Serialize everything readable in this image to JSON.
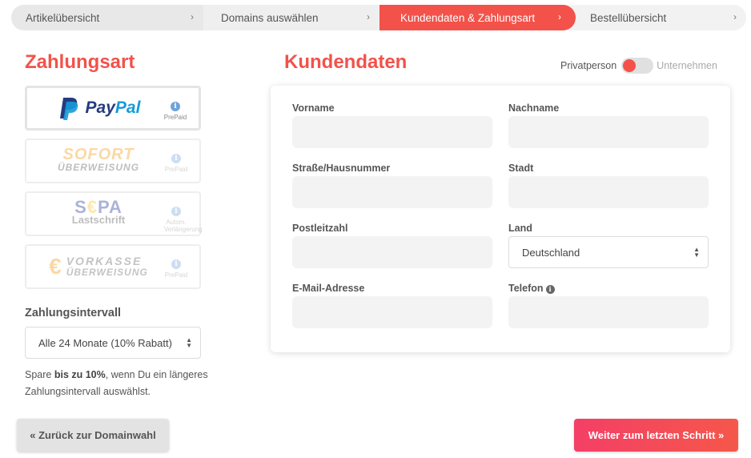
{
  "stepper": {
    "steps": [
      {
        "label": "Artikelübersicht"
      },
      {
        "label": "Domains auswählen"
      },
      {
        "label": "Kundendaten & Zahlungsart"
      },
      {
        "label": "Bestellübersicht"
      }
    ],
    "chevron": "›"
  },
  "payment": {
    "title": "Zahlungsart",
    "methods": [
      {
        "name": "PayPal",
        "logo_a": "Pay",
        "logo_b": "Pal",
        "note": "PrePaid",
        "selected": true
      },
      {
        "name": "Sofort Überweisung",
        "logo_a": "SOFORT",
        "logo_b": "ÜBERWEISUNG",
        "note": "PrePaid",
        "selected": false
      },
      {
        "name": "SEPA Lastschrift",
        "logo_a_1": "S",
        "logo_a_2": "€",
        "logo_a_3": "PA",
        "logo_b": "Lastschrift",
        "note_1": "Autom.",
        "note_2": "Verlängerung",
        "selected": false
      },
      {
        "name": "Vorkasse Überweisung",
        "euro": "€",
        "logo_a": "VORKASSE",
        "logo_b": "ÜBERWEISUNG",
        "note": "PrePaid",
        "selected": false
      }
    ],
    "info_glyph": "i",
    "interval_label": "Zahlungsintervall",
    "interval_value": "Alle 24 Monate (10% Rabatt)",
    "savings_1": "Spare ",
    "savings_bold": "bis zu 10%",
    "savings_2": ", wenn Du ein längeres Zahlungsintervall auswählst."
  },
  "customer": {
    "title": "Kundendaten",
    "toggle_left": "Privatperson",
    "toggle_right": "Unternehmen",
    "fields": {
      "firstname": "Vorname",
      "lastname": "Nachname",
      "street": "Straße/Hausnummer",
      "city": "Stadt",
      "zip": "Postleitzahl",
      "country": "Land",
      "country_value": "Deutschland",
      "email": "E-Mail-Adresse",
      "phone": "Telefon"
    }
  },
  "buttons": {
    "back": "« Zurück zur Domainwahl",
    "next": "Weiter zum letzten Schritt »"
  },
  "colors": {
    "accent": "#f2524a",
    "paypal_dark": "#253b80",
    "paypal_light": "#179bd7",
    "sofort": "#f39200",
    "sepa_blue": "#10298e",
    "sepa_yellow": "#ffbe00"
  }
}
